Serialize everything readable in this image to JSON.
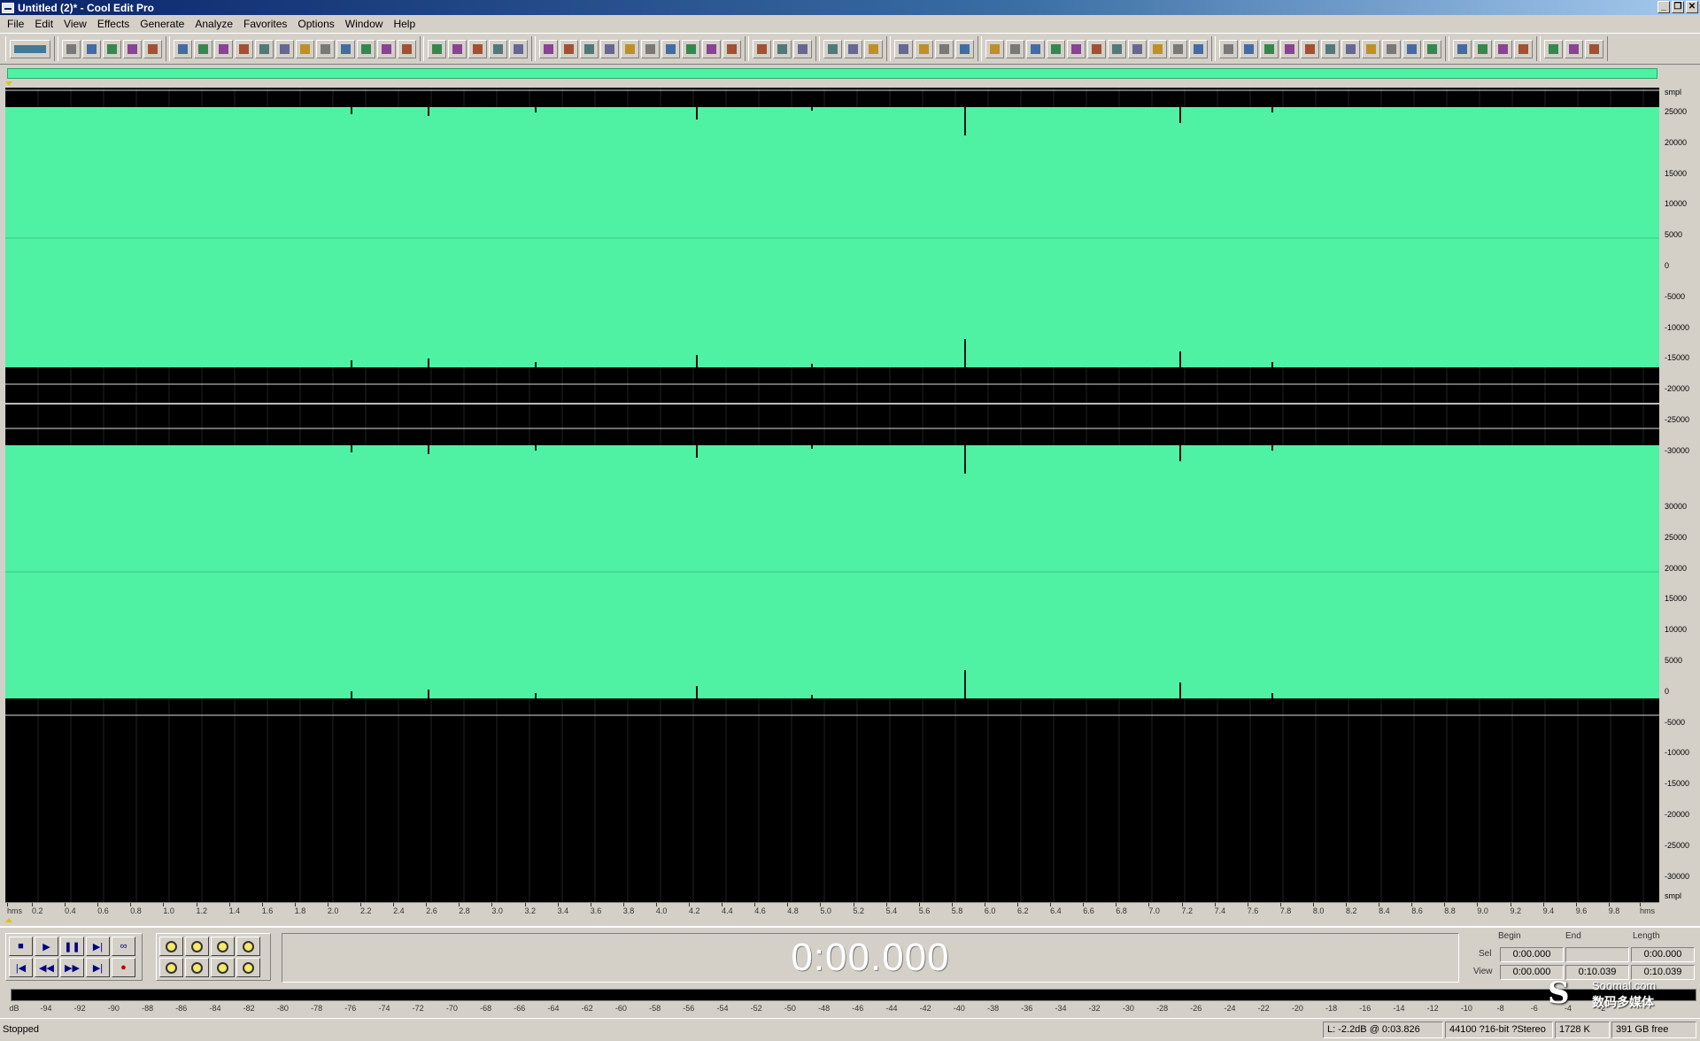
{
  "window": {
    "title": "Untitled (2)* - Cool Edit Pro",
    "buttons": [
      "_",
      "❐",
      "✕"
    ]
  },
  "menu": [
    "File",
    "Edit",
    "View",
    "Effects",
    "Generate",
    "Analyze",
    "Favorites",
    "Options",
    "Window",
    "Help"
  ],
  "toolbar_groups": [
    {
      "name": "mode",
      "count": 1
    },
    {
      "name": "file",
      "count": 5
    },
    {
      "name": "edit",
      "count": 12
    },
    {
      "name": "view",
      "count": 5
    },
    {
      "name": "window",
      "count": 10
    },
    {
      "name": "help",
      "count": 3
    },
    {
      "name": "options",
      "count": 3
    },
    {
      "name": "effects",
      "count": 4
    },
    {
      "name": "transform",
      "count": 11
    },
    {
      "name": "filters",
      "count": 11
    },
    {
      "name": "generate",
      "count": 4
    },
    {
      "name": "misc",
      "count": 3
    }
  ],
  "waveform": {
    "color": "#4ef2a2",
    "background": "#000000",
    "units_label_top": "smpl",
    "units_label_bottom": "smpl",
    "scale_labels": [
      "25000",
      "20000",
      "15000",
      "10000",
      "5000",
      "0",
      "-5000",
      "-10000",
      "-15000",
      "-20000",
      "-25000",
      "-30000"
    ],
    "scale_labels_bottom": [
      "30000",
      "25000",
      "20000",
      "15000",
      "10000",
      "5000",
      "0",
      "-5000",
      "-10000",
      "-15000",
      "-20000",
      "-25000",
      "-30000"
    ]
  },
  "time_axis": {
    "start_label": "hms",
    "end_label": "hms",
    "ticks": [
      "0.2",
      "0.4",
      "0.6",
      "0.8",
      "1.0",
      "1.2",
      "1.4",
      "1.6",
      "1.8",
      "2.0",
      "2.2",
      "2.4",
      "2.6",
      "2.8",
      "3.0",
      "3.2",
      "3.4",
      "3.6",
      "3.8",
      "4.0",
      "4.2",
      "4.4",
      "4.6",
      "4.8",
      "5.0",
      "5.2",
      "5.4",
      "5.6",
      "5.8",
      "6.0",
      "6.2",
      "6.4",
      "6.6",
      "6.8",
      "7.0",
      "7.2",
      "7.4",
      "7.6",
      "7.8",
      "8.0",
      "8.2",
      "8.4",
      "8.6",
      "8.8",
      "9.0",
      "9.2",
      "9.4",
      "9.6",
      "9.8"
    ]
  },
  "transport": {
    "row1": [
      "■",
      "▶",
      "❚❚",
      "▶|",
      "∞"
    ],
    "row2": [
      "|◀",
      "◀◀",
      "▶▶",
      "▶|",
      "●"
    ],
    "time": "0:00.000"
  },
  "selection": {
    "headers": {
      "begin": "Begin",
      "end": "End",
      "length": "Length"
    },
    "sel_label": "Sel",
    "view_label": "View",
    "sel": {
      "begin": "0:00.000",
      "end": "",
      "length": "0:00.000"
    },
    "view": {
      "begin": "0:00.000",
      "end": "0:10.039",
      "length": "0:10.039"
    }
  },
  "meter": {
    "start_label": "dB",
    "ticks": [
      "-94",
      "-92",
      "-90",
      "-88",
      "-86",
      "-84",
      "-82",
      "-80",
      "-78",
      "-76",
      "-74",
      "-72",
      "-70",
      "-68",
      "-66",
      "-64",
      "-62",
      "-60",
      "-58",
      "-56",
      "-54",
      "-52",
      "-50",
      "-48",
      "-46",
      "-44",
      "-42",
      "-40",
      "-38",
      "-36",
      "-34",
      "-32",
      "-30",
      "-28",
      "-26",
      "-24",
      "-22",
      "-20",
      "-18",
      "-16",
      "-14",
      "-12",
      "-10",
      "-8",
      "-6",
      "-4",
      "-2"
    ]
  },
  "watermark": {
    "logo": "S",
    "line1": "Soomal.com",
    "line2": "数码多媒体"
  },
  "status": {
    "state": "Stopped",
    "level": "L: -2.2dB @  0:03.826",
    "format": "44100 ?16-bit ?Stereo",
    "size": "1728 K",
    "free": "391 GB free"
  }
}
